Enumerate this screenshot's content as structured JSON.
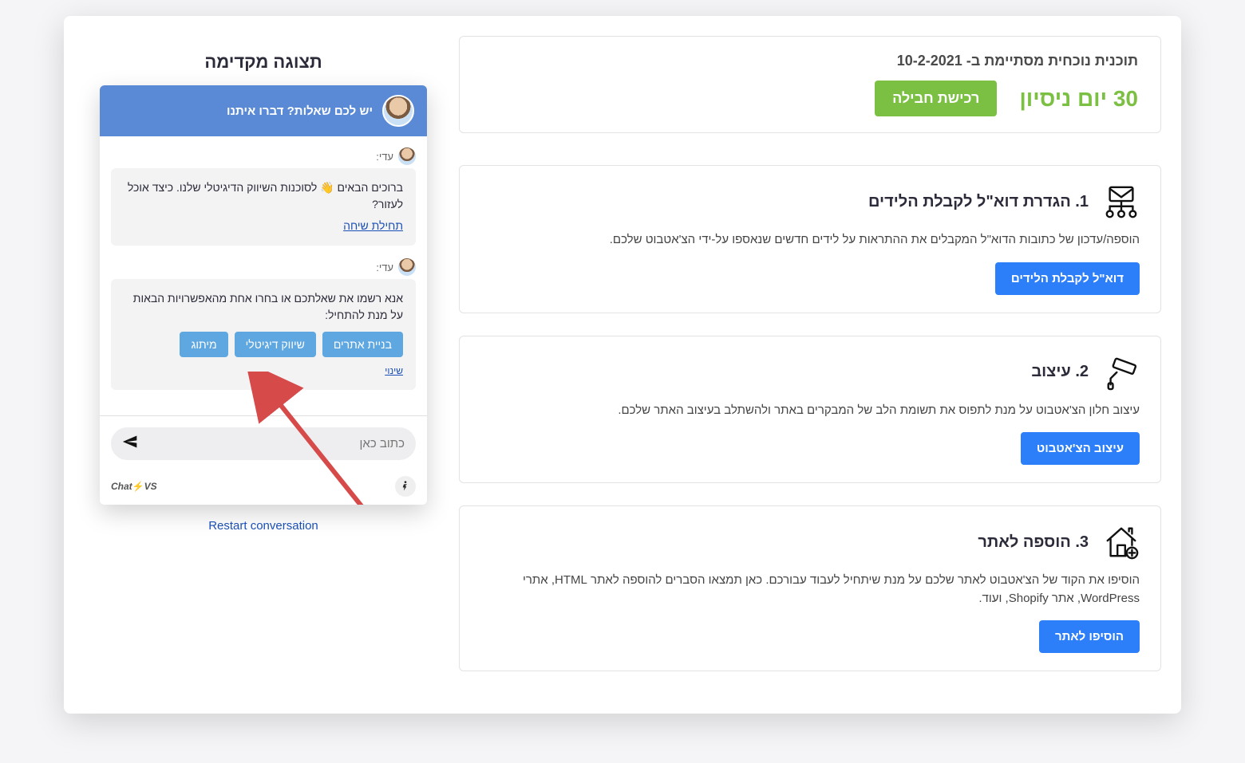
{
  "plan": {
    "text": "תוכנית נוכחית מסתיימת ב- 10-2-2021",
    "trial": "30 יום ניסיון",
    "buy": "רכישת חבילה"
  },
  "steps": [
    {
      "title": "1. הגדרת דוא\"ל לקבלת הלידים",
      "desc": "הוספה/עדכון של כתובות הדוא\"ל המקבלים את ההתראות על לידים חדשים שנאספו על-ידי הצ'אטבוט שלכם.",
      "btn": "דוא\"ל לקבלת הלידים"
    },
    {
      "title": "2. עיצוב",
      "desc": "עיצוב חלון הצ'אטבוט על מנת לתפוס את תשומת הלב של המבקרים באתר ולהשתלב בעיצוב האתר שלכם.",
      "btn": "עיצוב הצ'אטבוט"
    },
    {
      "title": "3. הוספה לאתר",
      "desc": "הוסיפו את הקוד של הצ'אטבוט לאתר שלכם על מנת שיתחיל לעבוד עבורכם. כאן תמצאו הסברים להוספה לאתר HTML, אתרי WordPress, אתר Shopify, ועוד.",
      "btn": "הוסיפו לאתר"
    }
  ],
  "preview": {
    "title": "תצוגה מקדימה",
    "restart": "Restart conversation"
  },
  "chat": {
    "header": "יש לכם שאלות? דברו איתנו",
    "agent": "עדי:",
    "msg1": "ברוכים הבאים 👋 לסוכנות השיווק הדיגיטלי שלנו. כיצד אוכל לעזור?",
    "start_link": "תחילת שיחה",
    "msg2": "אנא רשמו את שאלתכם או בחרו אחת מהאפשרויות הבאות על מנת להתחיל:",
    "chips": [
      "בניית אתרים",
      "שיווק דיגיטלי",
      "מיתוג"
    ],
    "change": "שינוי",
    "placeholder": "כתוב כאן",
    "brand_prefix": "Chat",
    "brand_suffix": "VS"
  }
}
